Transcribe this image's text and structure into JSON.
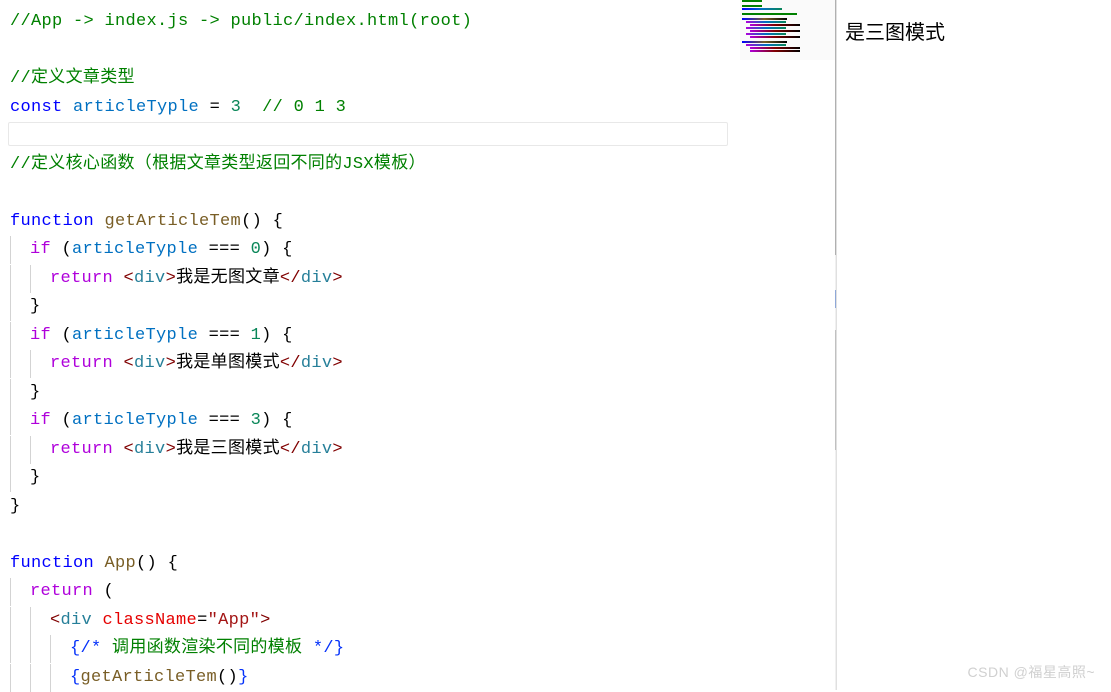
{
  "editor": {
    "line1_comment": "//App -> index.js -> public/index.html(root)",
    "line3_comment": "//定义文章类型",
    "line4": {
      "const_kw": "const",
      "var_name": "articleTyple",
      "eq": " = ",
      "value": "3",
      "trailing_comment": "  // 0 1 3"
    },
    "line6_comment": "//定义核心函数（根据文章类型返回不同的JSX模板）",
    "func1": {
      "fn_kw": "function",
      "name": "getArticleTem",
      "parens": "()",
      "open": " {",
      "if_kw": "if",
      "cond_var": "articleTyple",
      "triple_eq": " === ",
      "val0": "0",
      "val1": "1",
      "val3": "3",
      "cond_close": ") {",
      "return_kw": "return",
      "tag_open": "<",
      "tag_name": "div",
      "tag_gt": ">",
      "text0": "我是无图文章",
      "text1": "我是单图模式",
      "text3": "我是三图模式",
      "tag_close_open": "</",
      "close_brace": "}"
    },
    "func2": {
      "fn_kw": "function",
      "name": "App",
      "parens": "()",
      "open": " {",
      "return_kw": "return",
      "open_paren": " (",
      "tag_open": "<",
      "div_name": "div",
      "attr_className": "className",
      "eq": "=",
      "quote": "\"",
      "attr_value": "App",
      "tag_gt": ">",
      "comment_open": "{/* ",
      "comment_text": "调用函数渲染不同的模板",
      "comment_close": " */}",
      "call_open": "{",
      "call_name": "getArticleTem",
      "call_parens": "()",
      "call_close": "}"
    }
  },
  "right_panel": {
    "text": "是三图模式"
  },
  "watermark": "CSDN @福星高照~"
}
